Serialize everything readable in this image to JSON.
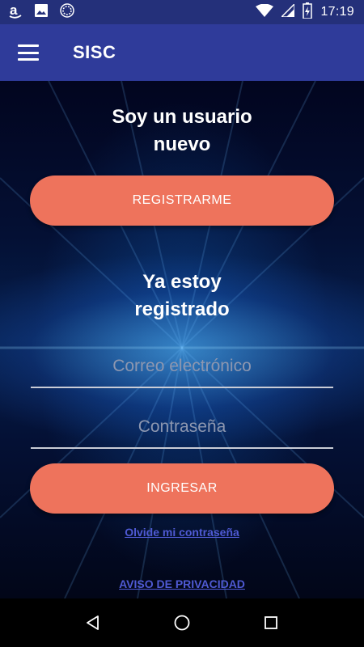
{
  "status_bar": {
    "time": "17:19",
    "left_icons": [
      "amazon-icon",
      "image-icon",
      "sync-icon"
    ],
    "right_icons": [
      "wifi-icon",
      "signal-icon",
      "battery-icon"
    ]
  },
  "app_bar": {
    "title": "SISC",
    "menu_icon": "menu-icon"
  },
  "new_user": {
    "heading_line1": "Soy un usuario",
    "heading_line2": "nuevo",
    "button": "REGISTRARME"
  },
  "login": {
    "heading_line1": "Ya estoy",
    "heading_line2": "registrado",
    "email_placeholder": "Correo electrónico",
    "password_placeholder": "Contraseña",
    "button": "INGRESAR",
    "forgot_link": "Olvide mi contraseña"
  },
  "privacy_link": "AVISO DE PRIVACIDAD",
  "nav_bar": {
    "icons": [
      "back-icon",
      "home-icon",
      "recents-icon"
    ]
  },
  "colors": {
    "accent": "#ee735c",
    "app_bar": "#2f3b9a",
    "status_bar": "#24307a",
    "link": "#4f5ad4"
  }
}
